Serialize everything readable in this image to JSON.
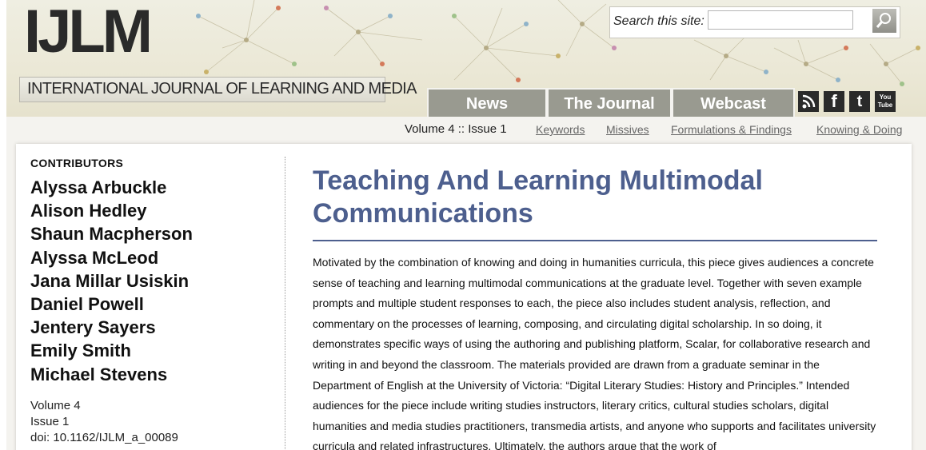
{
  "site": {
    "logo": "IJLM",
    "subtitle": "INTERNATIONAL JOURNAL OF LEARNING AND MEDIA"
  },
  "search": {
    "label": "Search this site:",
    "value": "",
    "button_icon": "search-icon"
  },
  "nav": {
    "tabs": [
      "News",
      "The Journal",
      "Webcast"
    ],
    "social_icons": [
      "rss-icon",
      "facebook-icon",
      "twitter-icon",
      "youtube-icon"
    ],
    "youtube_text": "You Tube"
  },
  "subnav": {
    "issue": "Volume 4 :: Issue 1",
    "links": [
      "Keywords",
      "Missives",
      "Formulations & Findings",
      "Knowing & Doing"
    ]
  },
  "sidebar": {
    "heading": "CONTRIBUTORS",
    "contributors": [
      "Alyssa Arbuckle",
      "Alison Hedley",
      "Shaun Macpherson",
      "Alyssa McLeod",
      "Jana Millar Usiskin",
      "Daniel Powell",
      "Jentery Sayers",
      "Emily Smith",
      "Michael Stevens"
    ],
    "volume": "Volume 4",
    "issue": "Issue 1",
    "doi": "doi: 10.1162/IJLM_a_00089"
  },
  "article": {
    "title": "Teaching And Learning Multimodal Communications",
    "abstract": "Motivated by the combination of knowing and doing in humanities curricula, this piece gives audiences a concrete sense of teaching and learning multimodal communications at the graduate level. Together with seven example prompts and multiple student responses to each, the piece also includes student analysis, reflection, and commentary on the processes of learning, composing, and circulating digital scholarship. In so doing, it demonstrates specific ways of using the authoring and publishing platform, Scalar, for collaborative research and writing in and beyond the classroom. The materials provided are drawn from a graduate seminar in the Department of English at the University of Victoria: “Digital Literary Studies: History and Principles.” Intended audiences for the piece include writing studies instructors, literary critics, cultural studies scholars, digital humanities and media studies practitioners, transmedia artists, and anyone who supports and facilitates university curricula and related infrastructures. Ultimately, the authors argue that the work of"
  },
  "colors": {
    "title_blue": "#4d5f8e",
    "nav_tab": "#999a90",
    "header_bg": "#ebe8d6"
  }
}
